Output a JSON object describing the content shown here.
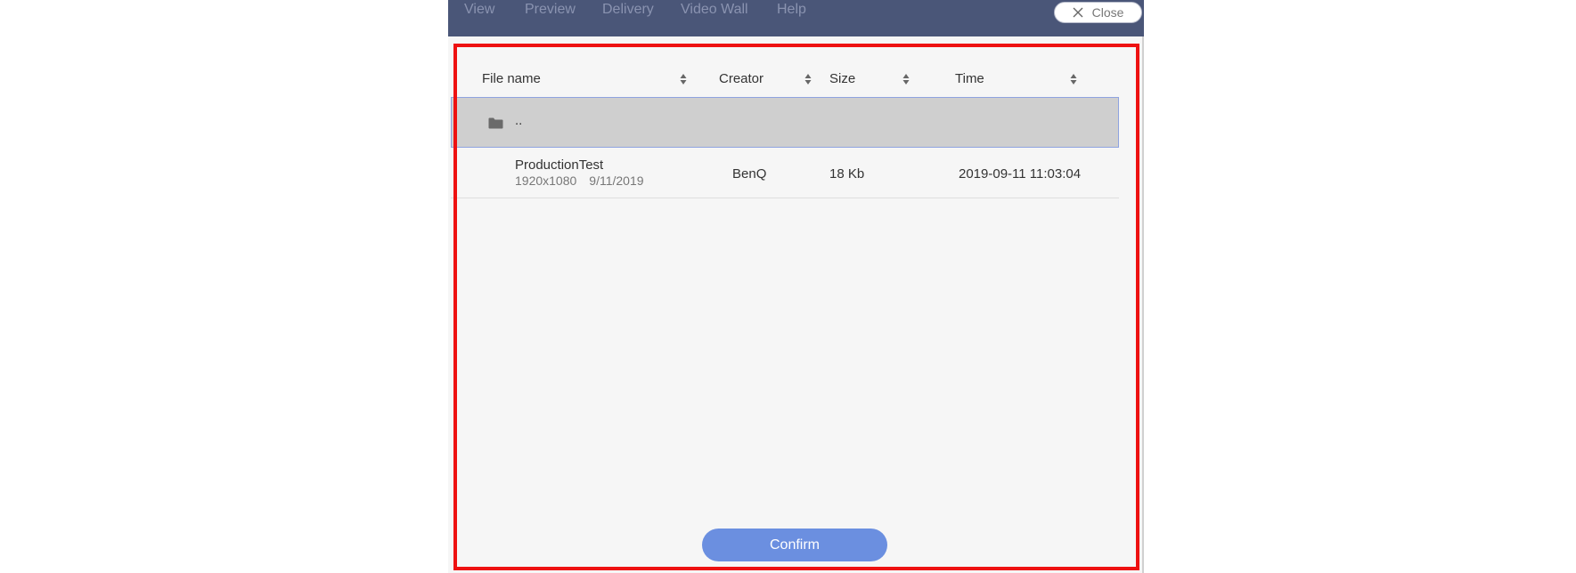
{
  "menu": {
    "items": [
      {
        "label": "View"
      },
      {
        "label": "Preview"
      },
      {
        "label": "Delivery"
      },
      {
        "label": "Video Wall"
      },
      {
        "label": "Help"
      }
    ],
    "close_label": "Close"
  },
  "table": {
    "columns": [
      {
        "label": "File name"
      },
      {
        "label": "Creator"
      },
      {
        "label": "Size"
      },
      {
        "label": "Time"
      }
    ],
    "parent_row": {
      "label": ".."
    },
    "rows": [
      {
        "name": "ProductionTest",
        "resolution": "1920x1080",
        "date": "9/11/2019",
        "creator": "BenQ",
        "size": "18 Kb",
        "time": "2019-09-11 11:03:04"
      }
    ]
  },
  "footer": {
    "confirm_label": "Confirm"
  },
  "colors": {
    "menubar": "#4a5678",
    "confirm": "#6b8fe0",
    "highlight": "#ee1111",
    "selected_row": "#cfcfcf"
  }
}
